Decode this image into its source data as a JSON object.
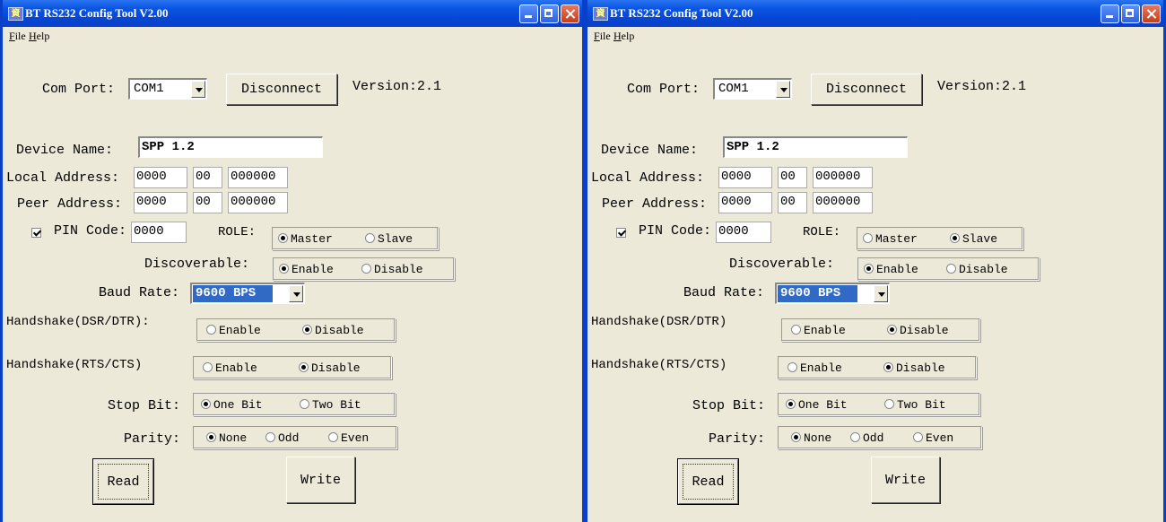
{
  "windows": [
    {
      "title": "BT RS232 Config Tool  V2.00",
      "app_icon": "program-icon",
      "menu": [
        "File",
        "Help"
      ],
      "com_port_label": "Com Port:",
      "com_port_value": "COM1",
      "disconnect_label": "Disconnect",
      "version_label": "Version:2.1",
      "device_name_label": "Device Name:",
      "device_name_value": "SPP 1.2",
      "local_address_label": "Local Address:",
      "local_address": [
        "0000",
        "00",
        "000000"
      ],
      "peer_address_label": "Peer Address:",
      "peer_address": [
        "0000",
        "00",
        "000000"
      ],
      "pin_code_label": "PIN Code:",
      "pin_code_checked": true,
      "pin_code_value": "0000",
      "role_label": "ROLE:",
      "role_options": [
        "Master",
        "Slave"
      ],
      "role_selected": "Master",
      "discoverable_label": "Discoverable:",
      "discoverable_options": [
        "Enable",
        "Disable"
      ],
      "discoverable_selected": "Enable",
      "baud_rate_label": "Baud Rate:",
      "baud_rate_value": "9600 BPS",
      "hs_dsr_label": "Handshake(DSR/DTR):",
      "hs_dsr_options": [
        "Enable",
        "Disable"
      ],
      "hs_dsr_selected": "Disable",
      "hs_rts_label": "Handshake(RTS/CTS)",
      "hs_rts_options": [
        "Enable",
        "Disable"
      ],
      "hs_rts_selected": "Disable",
      "stop_bit_label": "Stop Bit:",
      "stop_bit_options": [
        "One Bit",
        "Two Bit"
      ],
      "stop_bit_selected": "One Bit",
      "parity_label": "Parity:",
      "parity_options": [
        "None",
        "Odd",
        "Even"
      ],
      "parity_selected": "None",
      "read_label": "Read",
      "write_label": "Write"
    },
    {
      "title": "BT RS232 Config Tool  V2.00",
      "app_icon": "program-icon",
      "menu": [
        "File",
        "Help"
      ],
      "com_port_label": "Com Port:",
      "com_port_value": "COM1",
      "disconnect_label": "Disconnect",
      "version_label": "Version:2.1",
      "device_name_label": "Device Name:",
      "device_name_value": "SPP 1.2",
      "local_address_label": "Local Address:",
      "local_address": [
        "0000",
        "00",
        "000000"
      ],
      "peer_address_label": "Peer Address:",
      "peer_address": [
        "0000",
        "00",
        "000000"
      ],
      "pin_code_label": "PIN Code:",
      "pin_code_checked": true,
      "pin_code_value": "0000",
      "role_label": "ROLE:",
      "role_options": [
        "Master",
        "Slave"
      ],
      "role_selected": "Slave",
      "discoverable_label": "Discoverable:",
      "discoverable_options": [
        "Enable",
        "Disable"
      ],
      "discoverable_selected": "Enable",
      "baud_rate_label": "Baud Rate:",
      "baud_rate_value": "9600 BPS",
      "hs_dsr_label": "Handshake(DSR/DTR)",
      "hs_dsr_options": [
        "Enable",
        "Disable"
      ],
      "hs_dsr_selected": "Disable",
      "hs_rts_label": "Handshake(RTS/CTS)",
      "hs_rts_options": [
        "Enable",
        "Disable"
      ],
      "hs_rts_selected": "Disable",
      "stop_bit_label": "Stop Bit:",
      "stop_bit_options": [
        "One Bit",
        "Two Bit"
      ],
      "stop_bit_selected": "One Bit",
      "parity_label": "Parity:",
      "parity_options": [
        "None",
        "Odd",
        "Even"
      ],
      "parity_selected": "None",
      "read_label": "Read",
      "write_label": "Write"
    }
  ],
  "colors": {
    "titlebar": "#0a56e3",
    "face": "#ece9d8",
    "selection": "#316ac5",
    "close_button": "#c2401e"
  }
}
